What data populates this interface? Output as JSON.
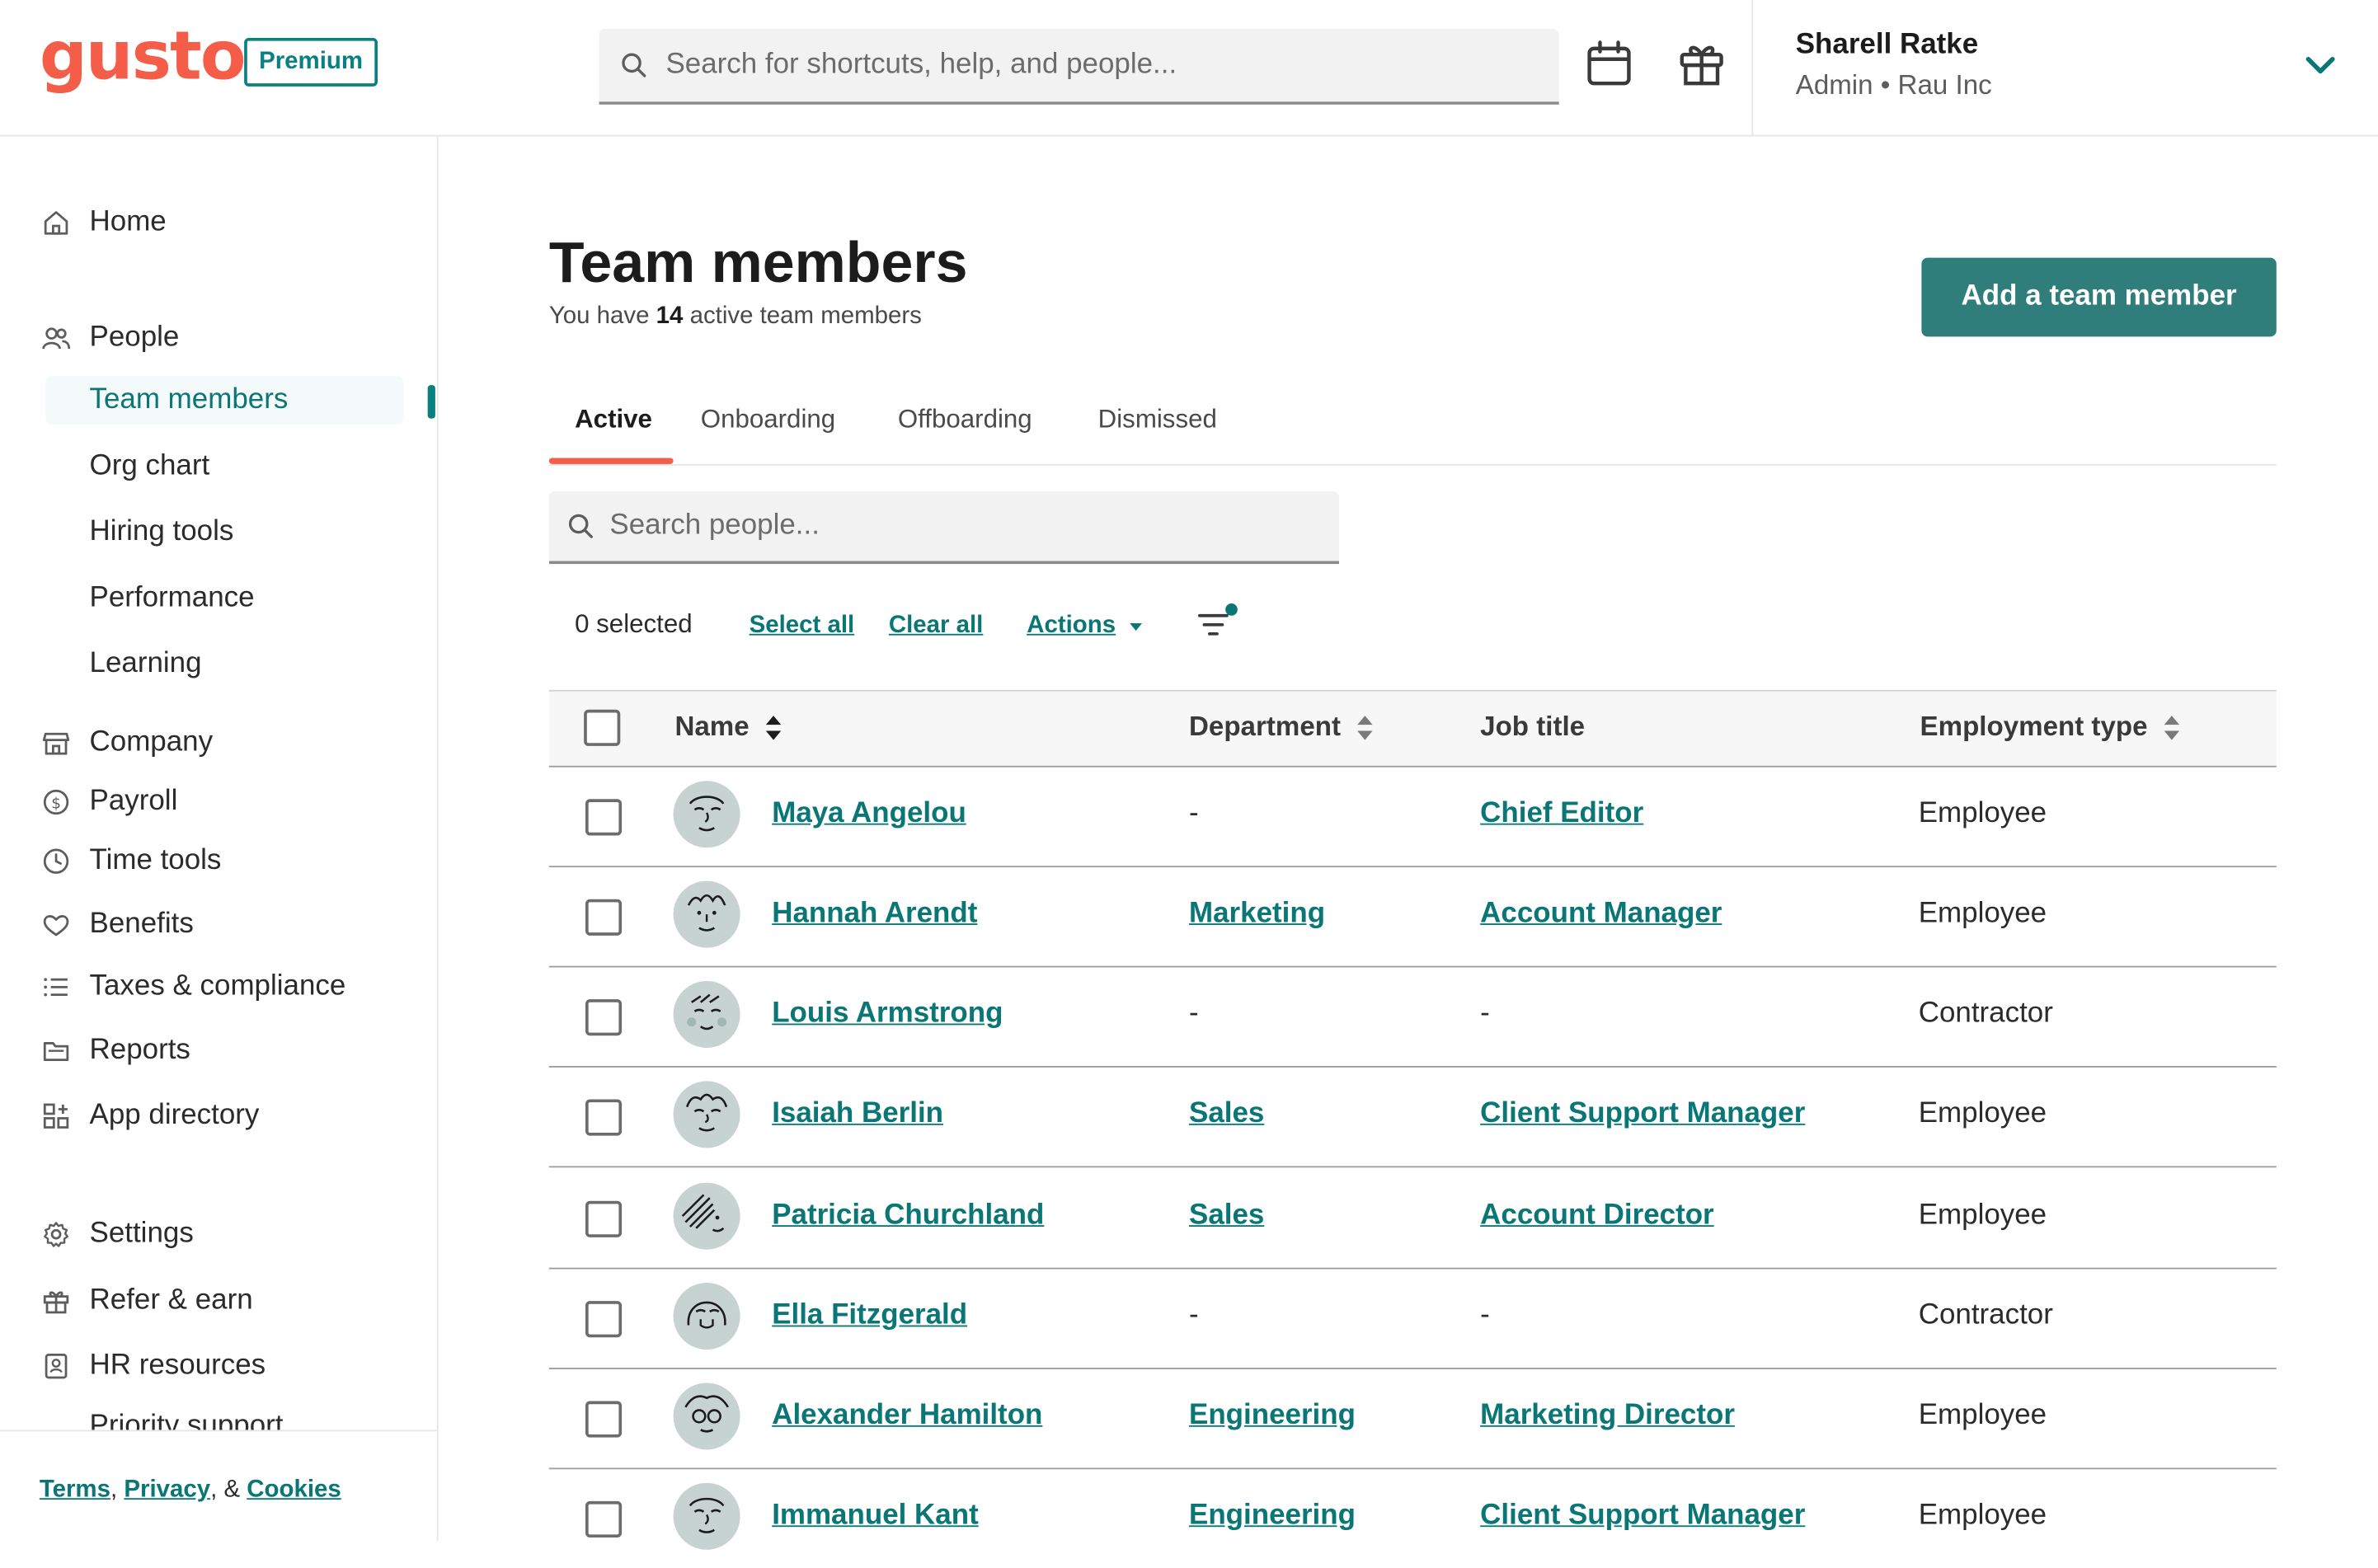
{
  "brand": {
    "logo_text": "gusto",
    "plan_badge": "Premium",
    "accent": "#0a8080",
    "logo_color": "#f45d48"
  },
  "header": {
    "search_placeholder": "Search for shortcuts, help, and people...",
    "user_name": "Sharell Ratke",
    "user_role": "Admin • Rau Inc"
  },
  "sidebar": {
    "home": "Home",
    "people": "People",
    "people_sub": [
      "Team members",
      "Org chart",
      "Hiring tools",
      "Performance",
      "Learning"
    ],
    "company": "Company",
    "payroll": "Payroll",
    "time_tools": "Time tools",
    "benefits": "Benefits",
    "taxes": "Taxes & compliance",
    "reports": "Reports",
    "app_directory": "App directory",
    "settings": "Settings",
    "refer": "Refer & earn",
    "hr_resources": "HR resources",
    "priority_support": "Priority support",
    "footer": {
      "terms": "Terms",
      "privacy": "Privacy",
      "sep1": ",",
      "sep2": ", &",
      "cookies": "Cookies"
    }
  },
  "main": {
    "title": "Team members",
    "subtitle_prefix": "You have ",
    "subtitle_count": "14",
    "subtitle_suffix": " active team members",
    "add_button": "Add a team member",
    "tabs": [
      "Active",
      "Onboarding",
      "Offboarding",
      "Dismissed"
    ],
    "people_search_placeholder": "Search people...",
    "selected_text": "0 selected",
    "select_all": "Select all",
    "clear_all": "Clear all",
    "actions": "Actions"
  },
  "table": {
    "columns": [
      "Name",
      "Department",
      "Job title",
      "Employment type"
    ],
    "rows": [
      {
        "name": "Maya Angelou",
        "department": "-",
        "job_title": "Chief Editor",
        "type": "Employee"
      },
      {
        "name": "Hannah Arendt",
        "department": "Marketing",
        "job_title": "Account Manager",
        "type": "Employee"
      },
      {
        "name": "Louis Armstrong",
        "department": "-",
        "job_title": "-",
        "type": "Contractor"
      },
      {
        "name": "Isaiah Berlin",
        "department": "Sales",
        "job_title": "Client Support Manager",
        "type": "Employee"
      },
      {
        "name": "Patricia Churchland",
        "department": "Sales",
        "job_title": "Account Director",
        "type": "Employee"
      },
      {
        "name": "Ella Fitzgerald",
        "department": "-",
        "job_title": "-",
        "type": "Contractor"
      },
      {
        "name": "Alexander Hamilton",
        "department": "Engineering",
        "job_title": "Marketing Director",
        "type": "Employee"
      },
      {
        "name": "Immanuel Kant",
        "department": "Engineering",
        "job_title": "Client Support Manager",
        "type": "Employee"
      }
    ]
  }
}
